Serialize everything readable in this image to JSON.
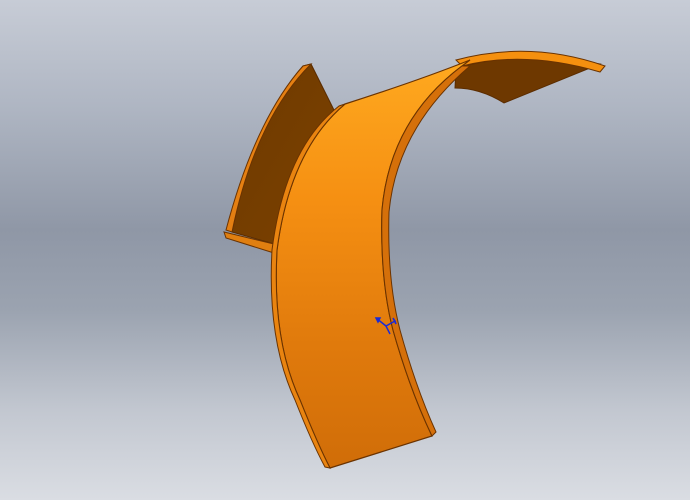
{
  "viewport": {
    "background_top": "#c7ccd6",
    "background_bottom": "#dadde3"
  },
  "model": {
    "part": "curved-sheet-metal-part",
    "face_color_light": "#ffa21c",
    "face_color_dark": "#c05a05",
    "edge_color": "#6b3300",
    "inner_face_color": "#7a3f00"
  },
  "triad": {
    "icon": "coordinate-triad-icon",
    "color": "#1a2bd6"
  }
}
